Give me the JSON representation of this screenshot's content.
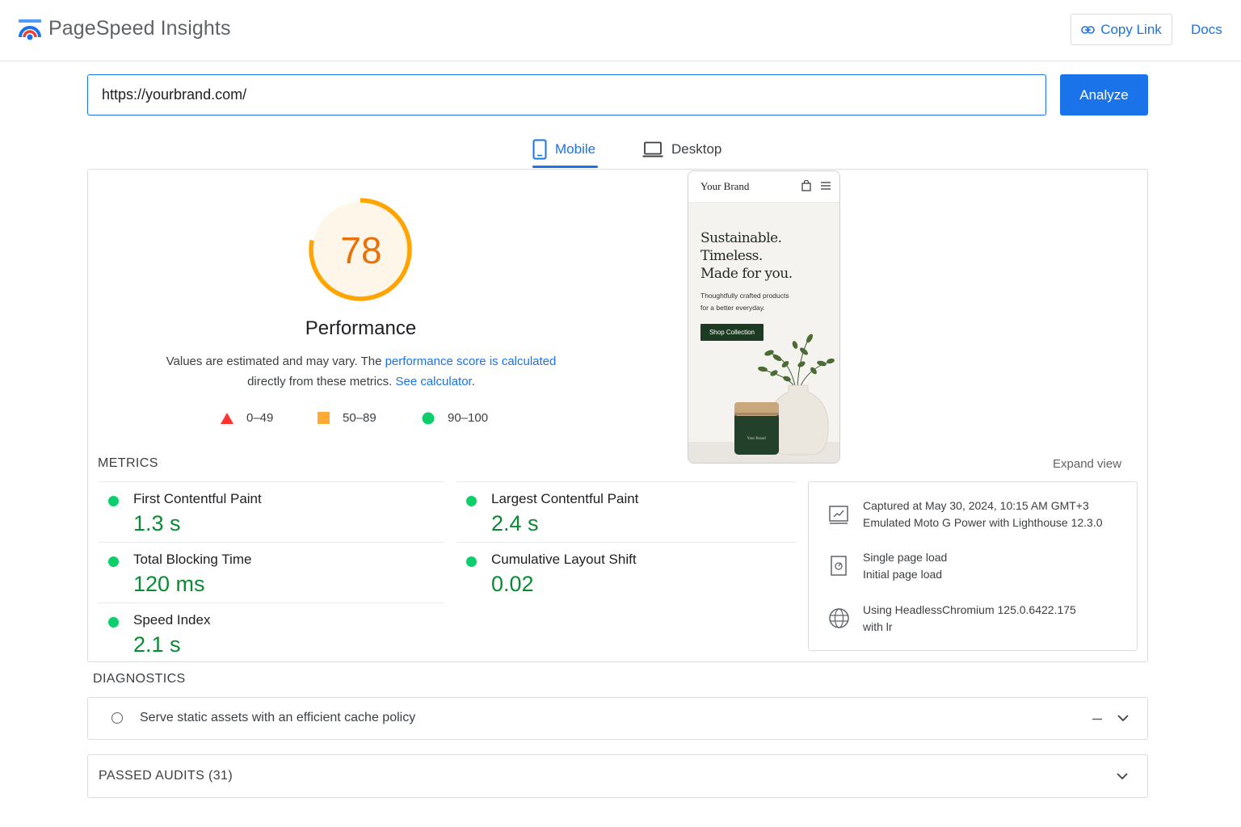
{
  "header": {
    "brand": "PageSpeed Insights",
    "copy_link": "Copy Link",
    "docs": "Docs"
  },
  "url_bar": {
    "value": "https://yourbrand.com/",
    "analyze": "Analyze"
  },
  "tabs": [
    {
      "label": "Mobile",
      "active": true
    },
    {
      "label": "Desktop",
      "active": false
    }
  ],
  "performance": {
    "score": "78",
    "score_fraction": 0.78,
    "title": "Performance",
    "note_prefix": "Values are estimated and may vary. The ",
    "note_link1": "performance score is calculated",
    "note_middle": " directly from these metrics. ",
    "note_link2": "See calculator",
    "note_suffix": ".",
    "legend": [
      {
        "range": "0–49",
        "color": "#ff3333"
      },
      {
        "range": "50–89",
        "color": "#ffaa33"
      },
      {
        "range": "90–100",
        "color": "#0cce6b"
      }
    ],
    "accent": "#ffa400"
  },
  "preview": {
    "brand": "Your Brand",
    "hero_line1": "Sustainable.",
    "hero_line2": "Timeless.",
    "hero_line3": "Made for you.",
    "sub_line1": "Thoughtfully crafted products",
    "sub_line2": "for a better everyday.",
    "cta": "Shop Collection",
    "jar_label": "Your Brand"
  },
  "metrics": {
    "heading": "METRICS",
    "expand": "Expand view",
    "items": [
      {
        "label": "First Contentful Paint",
        "value": "1.3 s"
      },
      {
        "label": "Largest Contentful Paint",
        "value": "2.4 s"
      },
      {
        "label": "Total Blocking Time",
        "value": "120 ms"
      },
      {
        "label": "Cumulative Layout Shift",
        "value": "0.02"
      },
      {
        "label": "Speed Index",
        "value": "2.1 s"
      }
    ]
  },
  "info": {
    "captured": "Captured at May 30, 2024, 10:15 AM GMT+3",
    "device": "Emulated Moto G Power with Lighthouse 12.3.0",
    "load1": "Single page load",
    "load2": "Initial page load",
    "browser1": "Using HeadlessChromium 125.0.6422.175",
    "browser2": "with lr"
  },
  "diagnostics": {
    "heading": "DIAGNOSTICS",
    "item": "Serve static assets with an efficient cache policy"
  },
  "passed": {
    "label": "PASSED AUDITS (31)"
  }
}
